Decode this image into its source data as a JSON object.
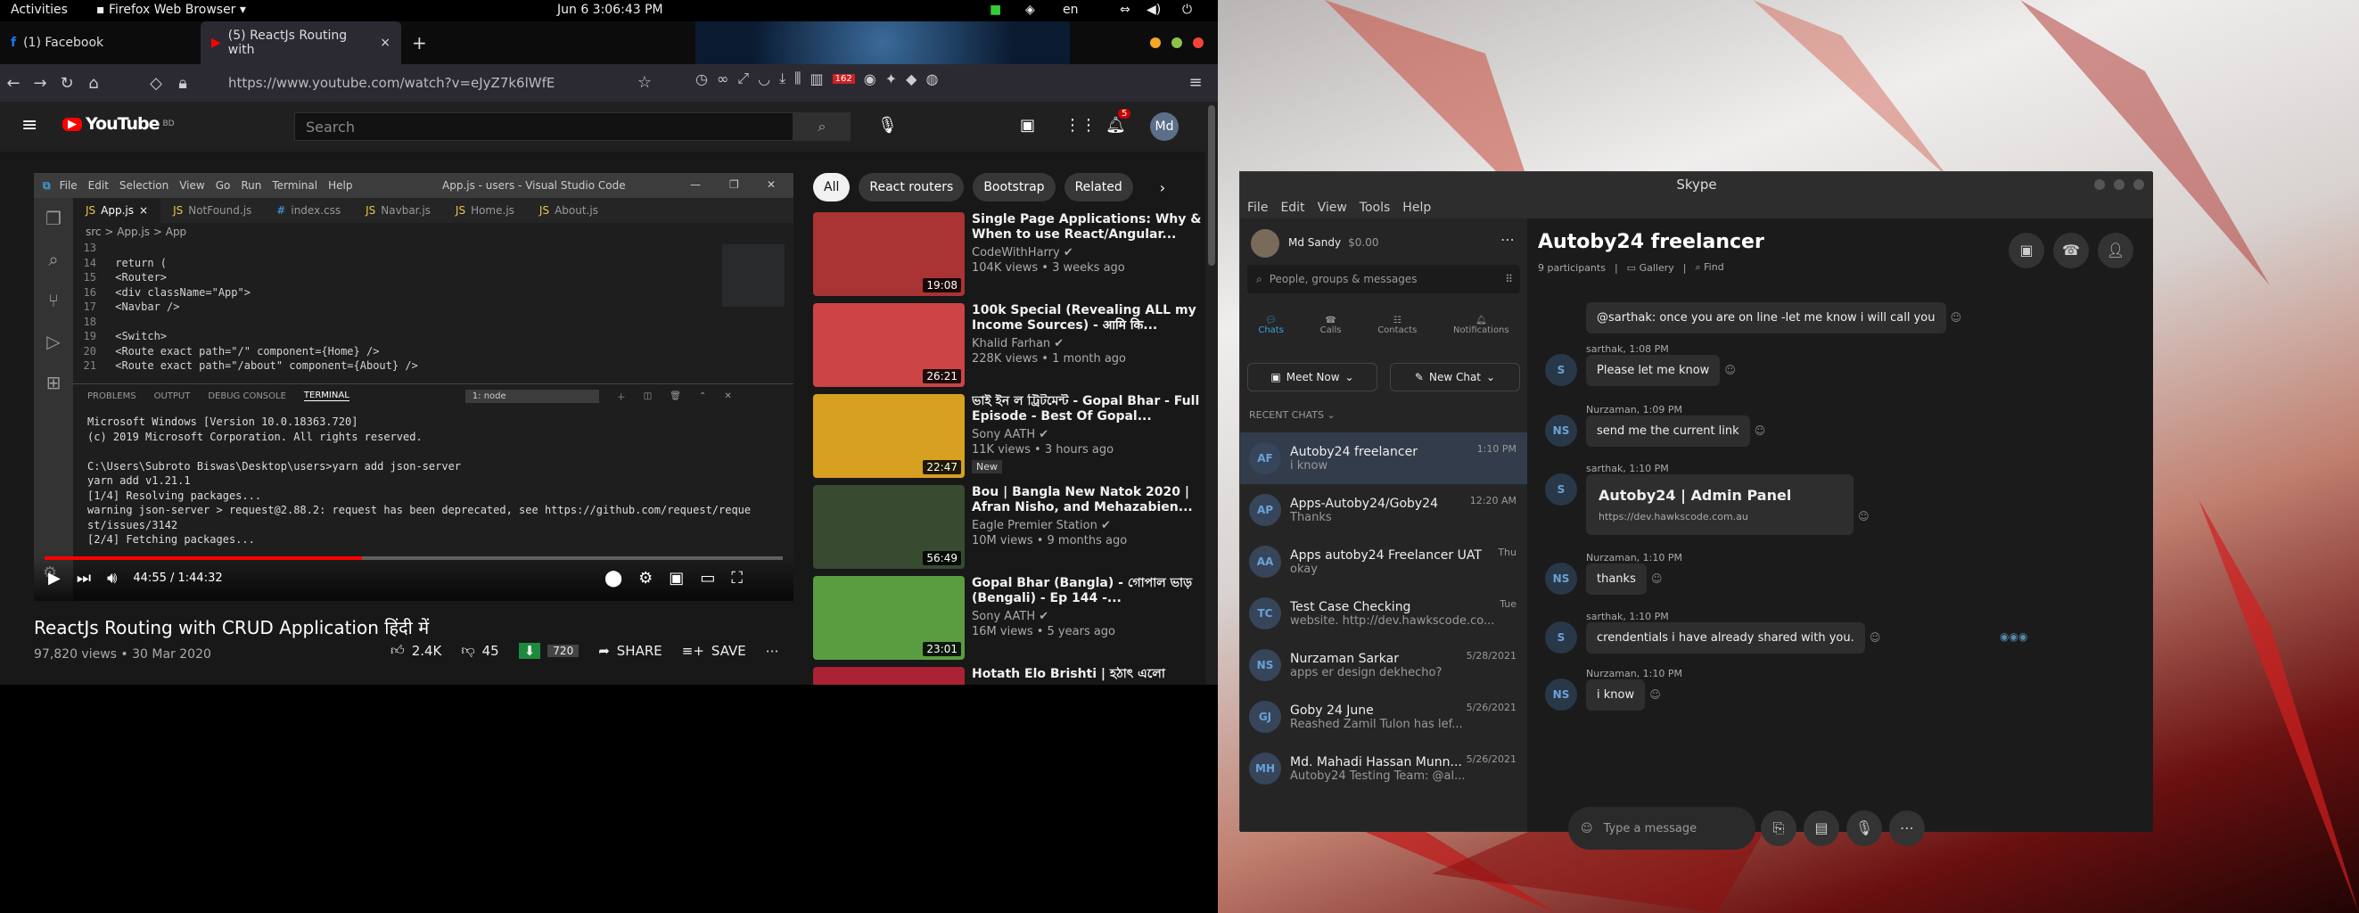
{
  "topbar": {
    "activities": "Activities",
    "app": "Firefox Web Browser",
    "datetime": "Jun 6  3:06:43 PM",
    "lang": "en"
  },
  "firefox": {
    "tabs": [
      {
        "label": "(1) Facebook"
      },
      {
        "label": "(5) ReactJs Routing with"
      }
    ],
    "new_tab": "+",
    "url": "https://www.youtube.com/watch?v=eJyZ7k6lWfE",
    "badge_count": "162"
  },
  "youtube": {
    "logo": "YouTube",
    "region": "BD",
    "search_placeholder": "Search",
    "notif_count": "5",
    "avatar": "Md",
    "chips": [
      "All",
      "React routers",
      "Bootstrap",
      "Related"
    ],
    "video": {
      "title": "ReactJs Routing with CRUD Application हिंदी में",
      "views": "97,820 views • 30 Mar 2020",
      "likes": "2.4K",
      "dislikes": "45",
      "quality": "720",
      "share": "SHARE",
      "save": "SAVE",
      "time": "44:55 / 1:44:32",
      "progress": 0.43
    },
    "recs": [
      {
        "title": "Single Page Applications: Why & When to use React/Angular...",
        "channel": "CodeWithHarry",
        "meta": "104K views • 3 weeks ago",
        "duration": "19:08",
        "thumb_color": "#a33"
      },
      {
        "title": "100k Special (Revealing ALL my Income Sources) - आमि कि...",
        "channel": "Khalid Farhan",
        "meta": "228K views • 1 month ago",
        "duration": "26:21",
        "thumb_color": "#c44"
      },
      {
        "title": "ভাই ইন ল ট্রিটমেন্ট - Gopal Bhar - Full Episode - Best Of Gopal...",
        "channel": "Sony AATH",
        "meta": "11K views • 3 hours ago",
        "duration": "22:47",
        "thumb_color": "#d8a020",
        "badge": "New"
      },
      {
        "title": "Bou | Bangla New Natok 2020 | Afran Nisho, and Mehazabien...",
        "channel": "Eagle Premier Station",
        "meta": "10M views • 9 months ago",
        "duration": "56:49",
        "thumb_color": "#384a30"
      },
      {
        "title": "Gopal Bhar (Bangla) - গোপাল ভাড় (Bengali) - Ep 144 -...",
        "channel": "Sony AATH",
        "meta": "16M views • 5 years ago",
        "duration": "23:01",
        "thumb_color": "#5a9d40"
      },
      {
        "title": "Hotath Elo Brishti | হঠাৎ এলো",
        "channel": "",
        "meta": "",
        "duration": "",
        "thumb_color": "#a23"
      }
    ]
  },
  "vscode": {
    "title": "App.js - users - Visual Studio Code",
    "menu": [
      "File",
      "Edit",
      "Selection",
      "View",
      "Go",
      "Run",
      "Terminal",
      "Help"
    ],
    "tabs": [
      "App.js",
      "NotFound.js",
      "index.css",
      "Navbar.js",
      "Home.js",
      "About.js"
    ],
    "breadcrumb": "src > App.js > App",
    "code": [
      {
        "n": "13",
        "t": ""
      },
      {
        "n": "14",
        "t": "    return ("
      },
      {
        "n": "15",
        "t": "      <Router>"
      },
      {
        "n": "16",
        "t": "        <div className=\"App\">"
      },
      {
        "n": "17",
        "t": "          <Navbar />"
      },
      {
        "n": "18",
        "t": ""
      },
      {
        "n": "19",
        "t": "          <Switch>"
      },
      {
        "n": "20",
        "t": "            <Route exact path=\"/\" component={Home} />"
      },
      {
        "n": "21",
        "t": "            <Route exact path=\"/about\" component={About} />"
      }
    ],
    "panel_tabs": [
      "PROBLEMS",
      "OUTPUT",
      "DEBUG CONSOLE",
      "TERMINAL"
    ],
    "terminal_select": "1: node",
    "terminal": "Microsoft Windows [Version 10.0.18363.720]\n(c) 2019 Microsoft Corporation. All rights reserved.\n\nC:\\Users\\Subroto Biswas\\Desktop\\users>yarn add json-server\nyarn add v1.21.1\n[1/4] Resolving packages...\nwarning json-server > request@2.88.2: request has been deprecated, see https://github.com/request/reque\nst/issues/3142\n[2/4] Fetching packages..."
  },
  "skype": {
    "title": "Skype",
    "menu": [
      "File",
      "Edit",
      "View",
      "Tools",
      "Help"
    ],
    "user": {
      "name": "Md Sandy",
      "credit": "$0.00"
    },
    "search_placeholder": "People, groups & messages",
    "nav": [
      "Chats",
      "Calls",
      "Contacts",
      "Notifications"
    ],
    "meet_now": "Meet Now",
    "new_chat": "New Chat",
    "recent": "RECENT CHATS",
    "chats": [
      {
        "av": "AF",
        "name": "Autoby24  freelancer",
        "preview": "i know",
        "time": "1:10 PM"
      },
      {
        "av": "AP",
        "name": "Apps-Autoby24/Goby24",
        "preview": "Thanks",
        "time": "12:20 AM"
      },
      {
        "av": "AA",
        "name": "Apps autoby24  Freelancer UAT",
        "preview": "okay",
        "time": "Thu"
      },
      {
        "av": "TC",
        "name": "Test Case Checking",
        "preview": "website. http://dev.hawkscode.co...",
        "time": "Tue"
      },
      {
        "av": "NS",
        "name": "Nurzaman Sarkar",
        "preview": "apps er design dekhecho?",
        "time": "5/28/2021"
      },
      {
        "av": "GJ",
        "name": "Goby 24 June",
        "preview": "Reashed Zamil Tulon has lef...",
        "time": "5/26/2021"
      },
      {
        "av": "MH",
        "name": "Md. Mahadi Hassan Munn...",
        "preview": "Autoby24 Testing Team: @al...",
        "time": "5/26/2021"
      }
    ],
    "conv": {
      "title": "Autoby24  freelancer",
      "participants": "9 participants",
      "gallery": "Gallery",
      "find": "Find",
      "messages": [
        {
          "author": "",
          "text": "@sarthak: once you are on line -let me know i will call you",
          "av": ""
        },
        {
          "author": "sarthak, 1:08 PM",
          "text": "Please let me know",
          "av": "S"
        },
        {
          "author": "Nurzaman, 1:09 PM",
          "text": "send me the current link",
          "av": "NS"
        },
        {
          "author": "sarthak, 1:10 PM",
          "text": "Autoby24 | Admin Panel",
          "link": "https://dev.hawkscode.com.au",
          "av": "S"
        },
        {
          "author": "Nurzaman, 1:10 PM",
          "text": "thanks",
          "av": "NS"
        },
        {
          "author": "sarthak, 1:10 PM",
          "text": "crendentials i have already shared with you.",
          "av": "S"
        },
        {
          "author": "Nurzaman, 1:10 PM",
          "text": "i know",
          "av": "NS"
        }
      ],
      "input_placeholder": "Type a message"
    }
  }
}
